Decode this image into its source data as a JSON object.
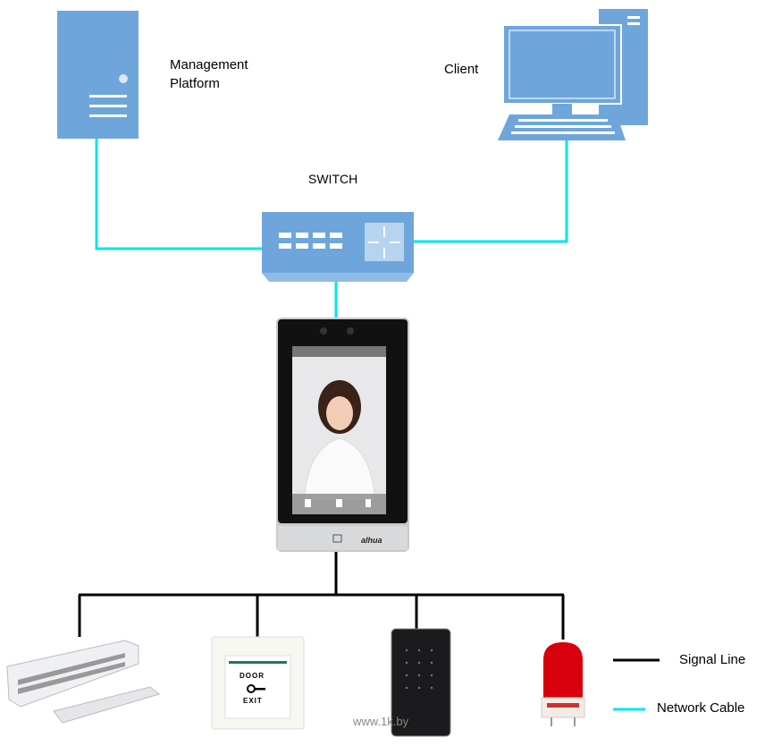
{
  "labels": {
    "management_platform": [
      "Management",
      "Platform"
    ],
    "client": "Client",
    "switch": "SWITCH"
  },
  "legend": {
    "signal_line": "Signal Line",
    "network_cable": "Network Cable"
  },
  "device": {
    "brand": "alhua"
  },
  "exit_button": {
    "top": "DOOR",
    "bottom": "EXIT"
  },
  "watermark": "www.1k.by",
  "colors": {
    "icon_blue": "#6ea6dc",
    "network_cable": "#00e5ee",
    "signal_line": "#000000",
    "alarm_red": "#d8000c"
  }
}
